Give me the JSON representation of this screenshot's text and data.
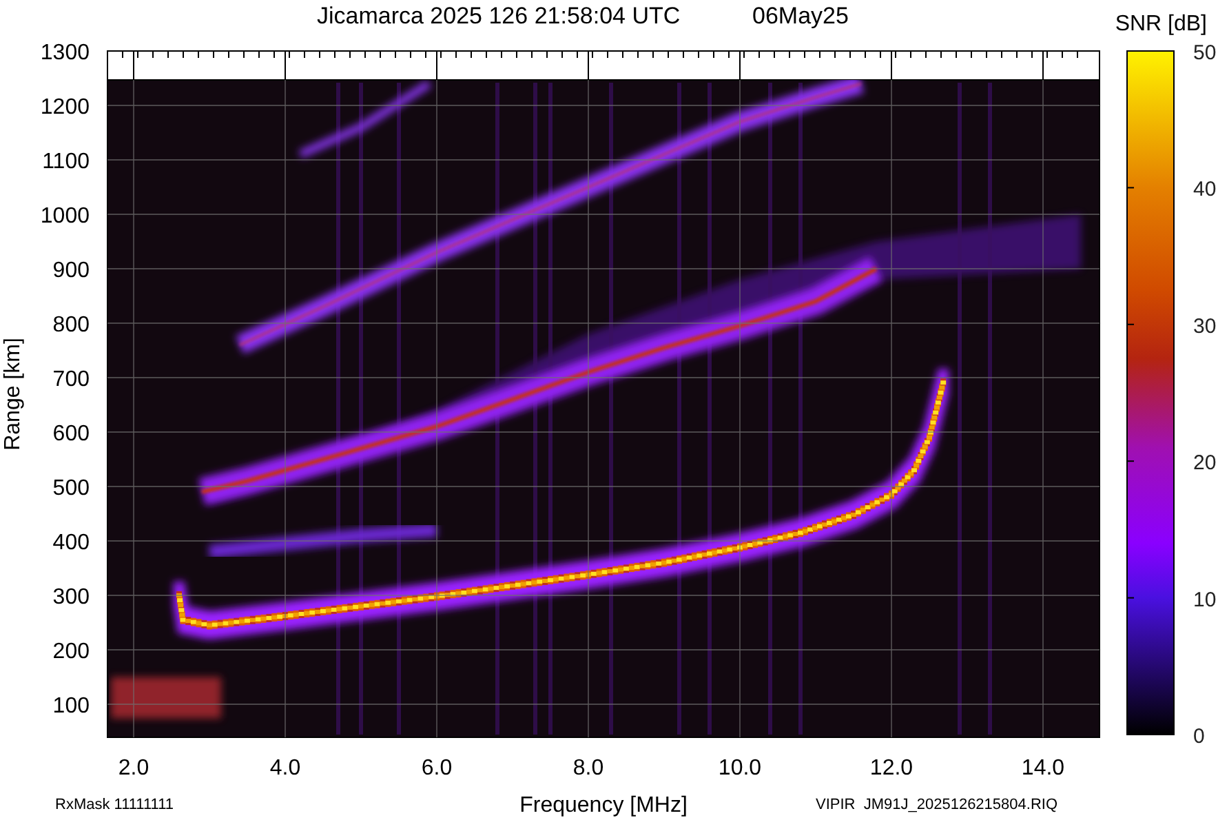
{
  "title": {
    "station": "Jicamarca 2025 126 21:58:04 UTC",
    "date": "06May25"
  },
  "colorbar": {
    "label": "SNR [dB]",
    "ticks": [
      "50",
      "40",
      "30",
      "20",
      "10",
      "0"
    ]
  },
  "y_axis": {
    "label": "Range [km]",
    "ticks": [
      "1300",
      "1200",
      "1100",
      "1000",
      "900",
      "800",
      "700",
      "600",
      "500",
      "400",
      "300",
      "200",
      "100"
    ]
  },
  "x_axis": {
    "label": "Frequency [MHz]",
    "ticks": [
      "2.0",
      "4.0",
      "6.0",
      "8.0",
      "10.0",
      "12.0",
      "14.0"
    ]
  },
  "footer": {
    "rx_mask": "RxMask 11111111",
    "file": "VIPIR  JM91J_2025126215804.RIQ"
  }
}
